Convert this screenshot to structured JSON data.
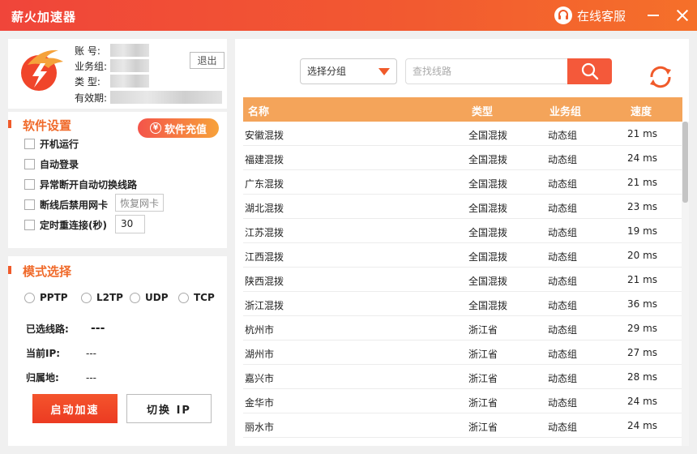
{
  "app": {
    "title": "薪火加速器",
    "service_label": "在线客服"
  },
  "account": {
    "labels": [
      "账 号:",
      "业务组:",
      "类 型:",
      "有效期:"
    ],
    "logout_label": "退出"
  },
  "settings": {
    "title": "软件设置",
    "recharge_label": "软件充值",
    "options": [
      "开机运行",
      "自动登录",
      "异常断开自动切换线路",
      "断线后禁用网卡",
      "定时重连接(秒)"
    ],
    "restore_nic_label": "恢复网卡",
    "reconnect_seconds": "30"
  },
  "mode": {
    "title": "模式选择",
    "protocols": [
      "PPTP",
      "L2TP",
      "UDP",
      "TCP"
    ],
    "selected_route_label": "已选线路:",
    "selected_route_value": "---",
    "current_ip_label": "当前IP:",
    "current_ip_value": "---",
    "location_label": "归属地:",
    "location_value": "---",
    "start_label": "启动加速",
    "switch_label": "切换 IP"
  },
  "routes": {
    "group_select": "选择分组",
    "search_placeholder": "查找线路",
    "columns": [
      "名称",
      "类型",
      "业务组",
      "速度"
    ],
    "rows": [
      [
        "安徽混拨",
        "全国混拨",
        "动态组",
        "21 ms"
      ],
      [
        "福建混拨",
        "全国混拨",
        "动态组",
        "24 ms"
      ],
      [
        "广东混拨",
        "全国混拨",
        "动态组",
        "21 ms"
      ],
      [
        "湖北混拨",
        "全国混拨",
        "动态组",
        "23 ms"
      ],
      [
        "江苏混拨",
        "全国混拨",
        "动态组",
        "19 ms"
      ],
      [
        "江西混拨",
        "全国混拨",
        "动态组",
        "20 ms"
      ],
      [
        "陕西混拨",
        "全国混拨",
        "动态组",
        "21 ms"
      ],
      [
        "浙江混拨",
        "全国混拨",
        "动态组",
        "36 ms"
      ],
      [
        "杭州市",
        "浙江省",
        "动态组",
        "29 ms"
      ],
      [
        "湖州市",
        "浙江省",
        "动态组",
        "27 ms"
      ],
      [
        "嘉兴市",
        "浙江省",
        "动态组",
        "28 ms"
      ],
      [
        "金华市",
        "浙江省",
        "动态组",
        "24 ms"
      ],
      [
        "丽水市",
        "浙江省",
        "动态组",
        "24 ms"
      ]
    ]
  },
  "colors": {
    "accent": "#f05a2a",
    "header": "#f4a45a"
  },
  "icons": {
    "service": "headset-icon",
    "search": "search-icon",
    "refresh": "refresh-icon",
    "logo": "flame-logo-icon"
  }
}
